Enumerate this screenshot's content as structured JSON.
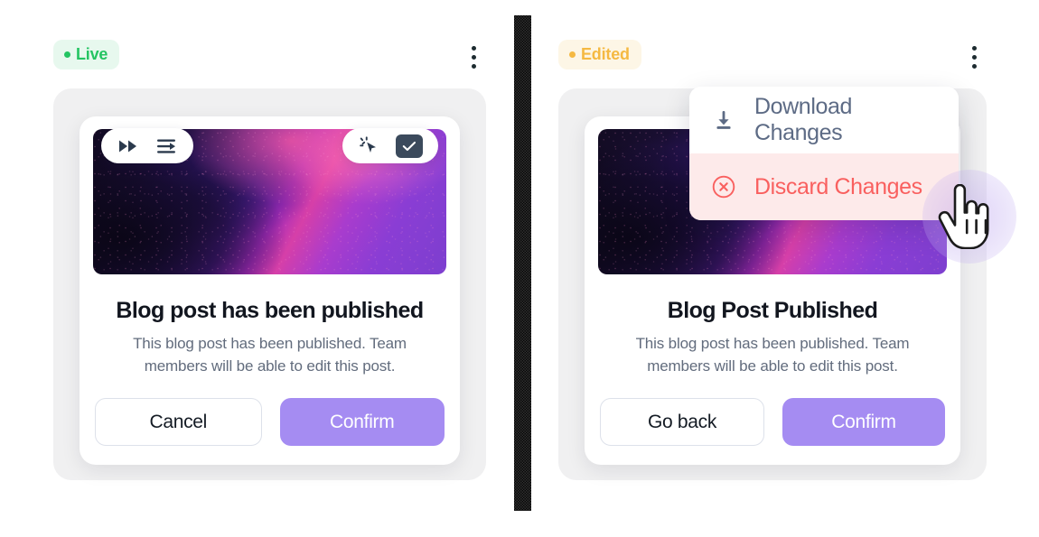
{
  "page": {
    "background_color": "#ffffff",
    "backdrop_texture_color": "#0c0c0c"
  },
  "colors": {
    "live_badge_text": "#24c462",
    "live_badge_bg": "#e7f8ee",
    "edited_badge_text": "#f5b942",
    "edited_badge_bg": "#fdf6e6",
    "primary_button": "#a58cf2",
    "discard_text": "#f9605f",
    "discard_bg": "#fdeaea",
    "download_text": "#5d6b85",
    "panel_bg": "#f0f0f1",
    "title_text": "#12161f",
    "body_text": "#626c7d"
  },
  "cards": [
    {
      "id": "left",
      "badge": {
        "label": "Live",
        "dot": true
      },
      "kebab_icon": "more-vertical-icon",
      "toolbar_left": [
        {
          "icon": "fast-forward-icon"
        },
        {
          "icon": "indent-arrow-icon"
        }
      ],
      "toolbar_right": [
        {
          "icon": "click-cursor-icon"
        },
        {
          "icon": "checkbox-checked-icon"
        }
      ],
      "dialog": {
        "title": "Blog post has been published",
        "body": "This blog post has been published. Team members will be able to edit this post.",
        "secondary_button": "Cancel",
        "primary_button": "Confirm"
      }
    },
    {
      "id": "right",
      "badge": {
        "label": "Edited",
        "dot": true
      },
      "kebab_icon": "more-vertical-icon",
      "toolbar_left": [
        {
          "icon": "fast-forward-icon"
        },
        {
          "icon": "indent-arrow-icon"
        }
      ],
      "dropdown": {
        "items": [
          {
            "label": "Download Changes",
            "icon": "download-icon",
            "state": "default"
          },
          {
            "label": "Discard Changes",
            "icon": "circle-x-icon",
            "state": "hovered"
          }
        ]
      },
      "dialog": {
        "title": "Blog Post Published",
        "body": "This blog post has been published. Team members will be able to edit this post.",
        "secondary_button": "Go back",
        "primary_button": "Confirm"
      }
    }
  ],
  "cursor": {
    "type": "pointing-hand-cursor",
    "highlight": true
  }
}
